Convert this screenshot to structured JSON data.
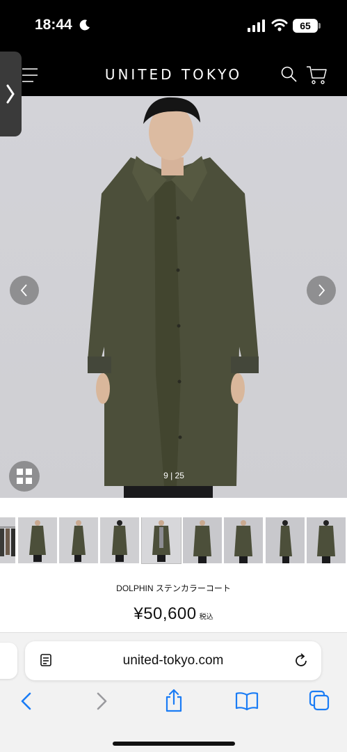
{
  "status_bar": {
    "time": "18:44",
    "battery": "65",
    "icons": [
      "moon-icon",
      "signal-icon",
      "wifi-icon",
      "battery-icon"
    ]
  },
  "header": {
    "brand": "UNITED TOKYO",
    "icons": [
      "menu-icon",
      "search-icon",
      "cart-icon"
    ]
  },
  "gallery": {
    "counter": "9 | 25",
    "icons": [
      "chevron-left-icon",
      "chevron-right-icon",
      "grid-icon"
    ],
    "thumbnail_count": 9
  },
  "product": {
    "name": "DOLPHIN ステンカラーコート",
    "price": "¥50,600",
    "tax_label": "税込"
  },
  "browser": {
    "url": "united-tokyo.com",
    "icons": [
      "reader-icon",
      "reload-icon",
      "back-icon",
      "forward-icon",
      "share-icon",
      "bookmarks-icon",
      "tabs-icon"
    ]
  },
  "colors": {
    "header_bg": "#000000",
    "browser_accent": "#1a7cf5",
    "coat": "#4c4f3a"
  }
}
